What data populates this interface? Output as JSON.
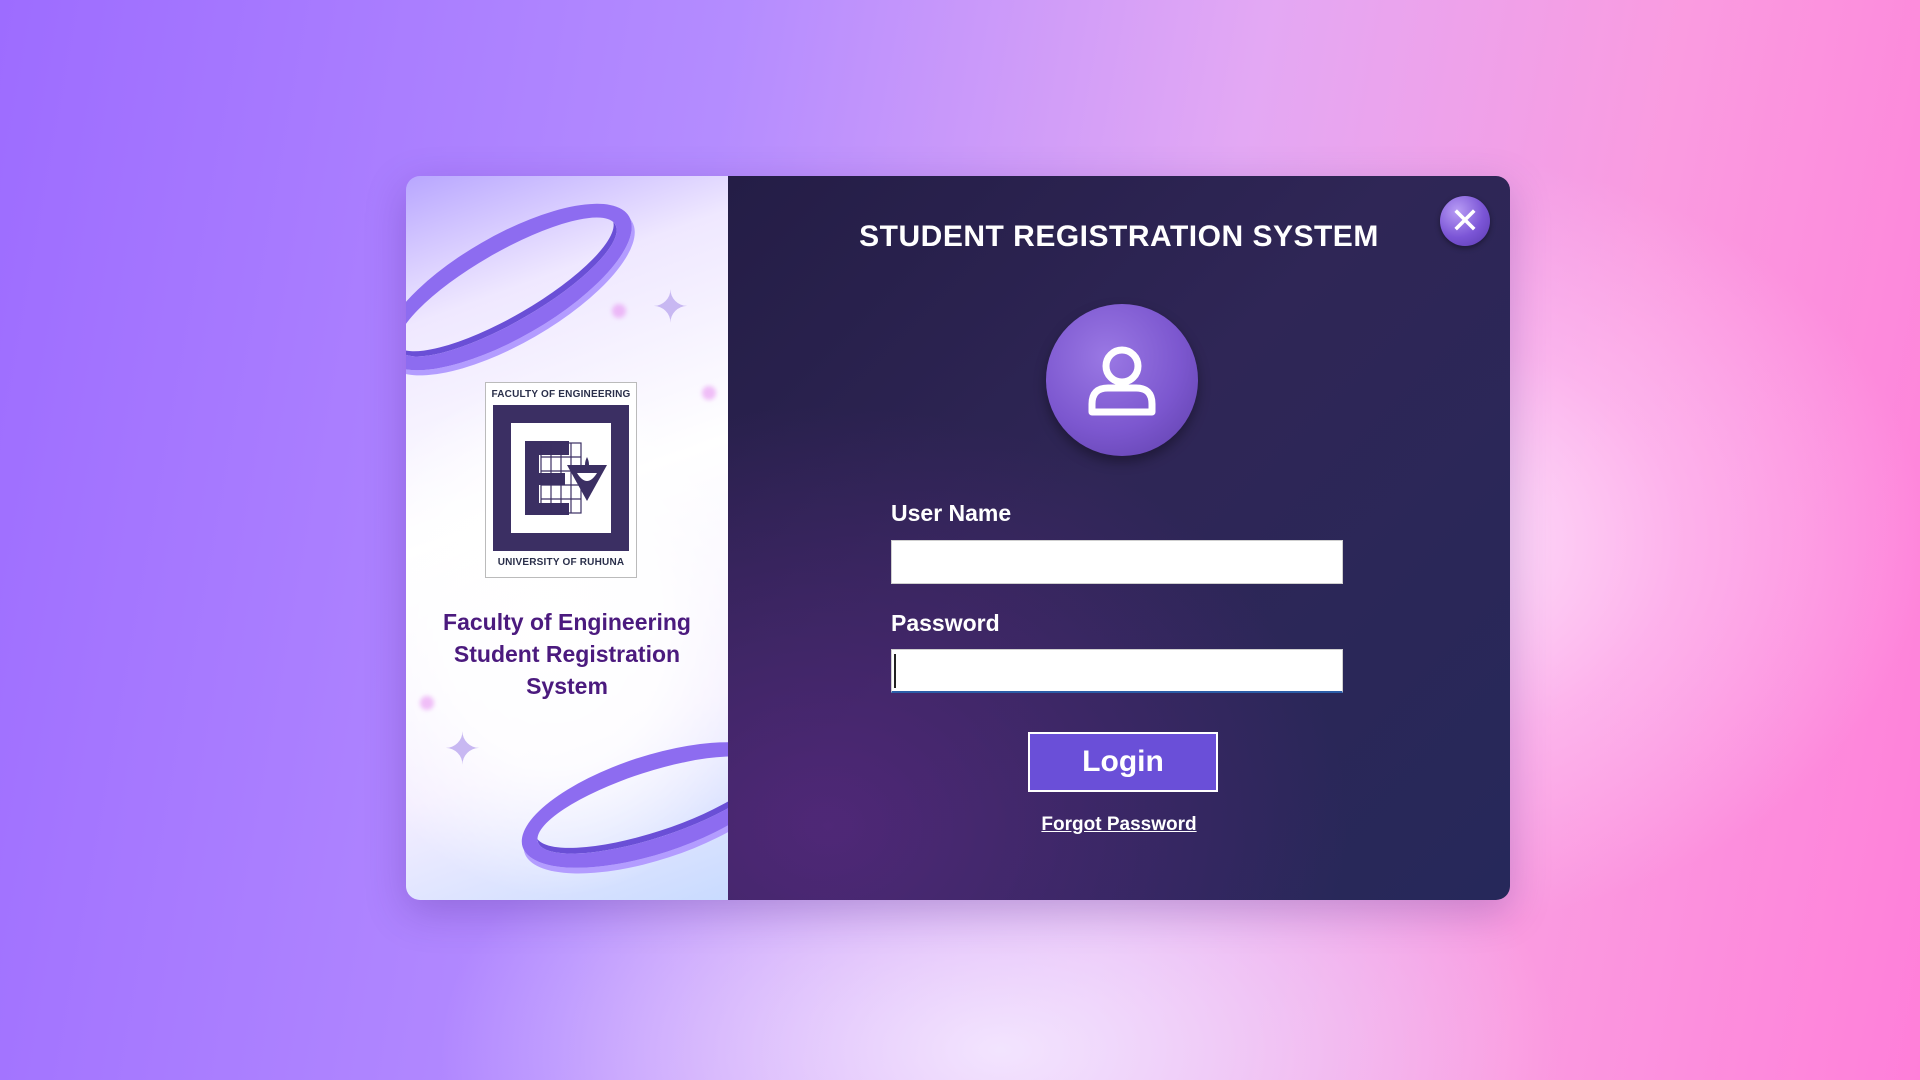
{
  "left_panel": {
    "logo": {
      "top_text": "FACULTY OF ENGINEERING",
      "bottom_text": "UNIVERSITY OF RUHUNA"
    },
    "title_lines": [
      "Faculty of Engineering",
      "Student Registration",
      "System"
    ]
  },
  "header": {
    "title": "STUDENT REGISTRATION SYSTEM"
  },
  "form": {
    "username_label": "User Name",
    "username_value": "",
    "password_label": "Password",
    "password_value": "",
    "login_label": "Login",
    "forgot_label": "Forgot Password"
  },
  "icons": {
    "close": "close-icon",
    "avatar": "user-icon"
  },
  "colors": {
    "accent": "#6a4fd8",
    "panel_dark": "#2a2350",
    "title_purple": "#4b1a7e"
  }
}
